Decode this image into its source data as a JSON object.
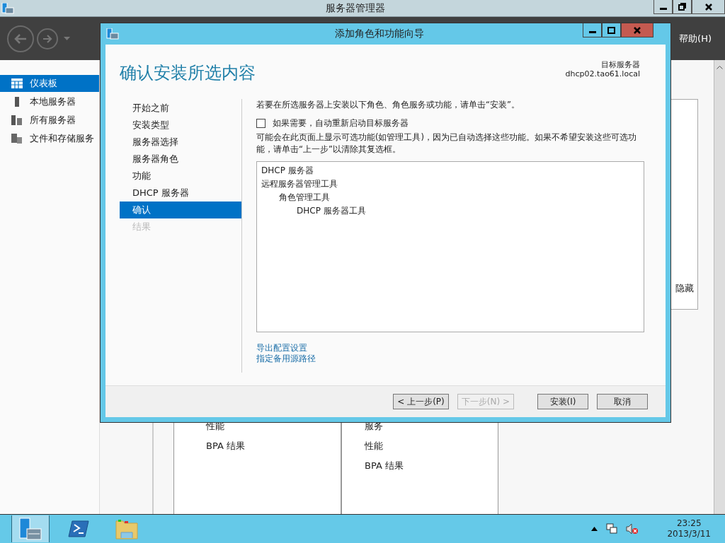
{
  "main_window": {
    "title": "服务器管理器",
    "help_menu": "帮助(H)"
  },
  "sidebar": {
    "items": [
      {
        "label": "仪表板",
        "selected": true
      },
      {
        "label": "本地服务器",
        "selected": false
      },
      {
        "label": "所有服务器",
        "selected": false
      },
      {
        "label": "文件和存储服务",
        "selected": false
      }
    ]
  },
  "side_panel": {
    "hide_link": "隐藏"
  },
  "tiles": [
    {
      "items": [
        "性能",
        "BPA 结果"
      ]
    },
    {
      "items": [
        "服务",
        "性能",
        "BPA 结果"
      ]
    }
  ],
  "dialog": {
    "title": "添加角色和功能向导",
    "heading": "确认安装所选内容",
    "target_label": "目标服务器",
    "target_server": "dhcp02.tao61.local",
    "steps": [
      {
        "label": "开始之前",
        "selected": false,
        "disabled": false
      },
      {
        "label": "安装类型",
        "selected": false,
        "disabled": false
      },
      {
        "label": "服务器选择",
        "selected": false,
        "disabled": false
      },
      {
        "label": "服务器角色",
        "selected": false,
        "disabled": false
      },
      {
        "label": "功能",
        "selected": false,
        "disabled": false
      },
      {
        "label": "DHCP 服务器",
        "selected": false,
        "disabled": false
      },
      {
        "label": "确认",
        "selected": true,
        "disabled": false
      },
      {
        "label": "结果",
        "selected": false,
        "disabled": true
      }
    ],
    "instruction": "若要在所选服务器上安装以下角色、角色服务或功能，请单击“安装”。",
    "restart_option": {
      "label": "如果需要，自动重新启动目标服务器",
      "checked": false
    },
    "note": "可能会在此页面上显示可选功能(如管理工具)，因为已自动选择这些功能。如果不希望安装这些可选功能，请单击“上一步”以清除其复选框。",
    "selection_tree": [
      {
        "label": "DHCP 服务器"
      },
      {
        "label": "远程服务器管理工具",
        "children": [
          {
            "label": "角色管理工具",
            "children": [
              {
                "label": "DHCP 服务器工具"
              }
            ]
          }
        ]
      }
    ],
    "links": [
      "导出配置设置",
      "指定备用源路径"
    ],
    "buttons": [
      {
        "label": "< 上一步(P)",
        "disabled": false
      },
      {
        "label": "下一步(N) >",
        "disabled": true
      },
      {
        "label": "安装(I)",
        "disabled": false
      },
      {
        "label": "取消",
        "disabled": false
      }
    ]
  },
  "taskbar": {
    "clock_time": "23:25",
    "clock_date": "2013/3/11"
  }
}
